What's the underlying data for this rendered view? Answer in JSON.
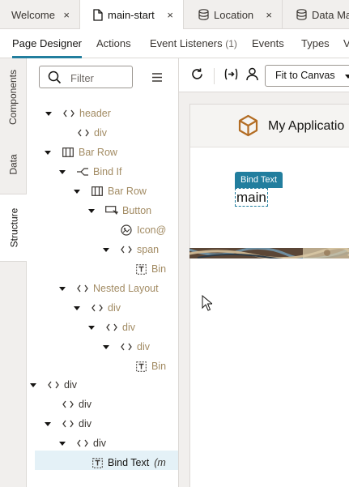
{
  "file_tabs": [
    {
      "label": "Welcome",
      "icon": "none",
      "active": false
    },
    {
      "label": "main-start",
      "icon": "file-icon",
      "active": true
    },
    {
      "label": "Location",
      "icon": "database-icon",
      "active": false
    },
    {
      "label": "Data Ma",
      "icon": "database-icon",
      "active": false
    }
  ],
  "close_glyph": "×",
  "editor_tabs": [
    {
      "label": "Page Designer",
      "count": "",
      "active": true
    },
    {
      "label": "Actions",
      "count": ""
    },
    {
      "label": "Event Listeners",
      "count": "(1)"
    },
    {
      "label": "Events",
      "count": ""
    },
    {
      "label": "Types",
      "count": ""
    },
    {
      "label": "V",
      "count": ""
    }
  ],
  "side_tabs": [
    "Components",
    "Data",
    "Structure"
  ],
  "structure": {
    "filter_placeholder": "Filter",
    "nodes": [
      {
        "label": "header",
        "icon": "code-icon",
        "twisty": true
      },
      {
        "label": "div",
        "icon": "code-icon",
        "twisty": false
      },
      {
        "label": "Bar Row",
        "icon": "bar-row-icon",
        "twisty": true
      },
      {
        "label": "Bind If",
        "icon": "bind-if-icon",
        "twisty": true
      },
      {
        "label": "Bar Row",
        "icon": "bar-row-icon",
        "twisty": true
      },
      {
        "label": "Button",
        "icon": "button-icon",
        "twisty": true
      },
      {
        "label": "Icon",
        "suffix": "@",
        "icon": "icon-component-icon",
        "twisty": false
      },
      {
        "label": "span",
        "icon": "code-icon",
        "twisty": true
      },
      {
        "label": "Bin",
        "icon": "bind-text-icon",
        "twisty": false
      },
      {
        "label": "Nested Layout",
        "icon": "code-icon",
        "twisty": true
      },
      {
        "label": "div",
        "icon": "code-icon",
        "twisty": true
      },
      {
        "label": "div",
        "icon": "code-icon",
        "twisty": true
      },
      {
        "label": "div",
        "icon": "code-icon",
        "twisty": true
      },
      {
        "label": "Bin",
        "icon": "bind-text-icon",
        "twisty": false
      },
      {
        "label": "div",
        "icon": "code-icon",
        "twisty": true
      },
      {
        "label": "div",
        "icon": "code-icon",
        "twisty": false
      },
      {
        "label": "div",
        "icon": "code-icon",
        "twisty": true
      },
      {
        "label": "div",
        "icon": "code-icon",
        "twisty": true
      },
      {
        "label": "Bind Text",
        "suffix": "(m",
        "icon": "bind-text-icon",
        "twisty": false,
        "selected": true
      }
    ]
  },
  "canvas_toolbar": {
    "zoom_select": "Fit to Canvas",
    "icons": [
      "refresh-icon",
      "variable-icon",
      "user-icon"
    ]
  },
  "canvas": {
    "app_title": "My Applicatio",
    "bind_text_badge": "Bind Text",
    "main_text": "main"
  },
  "colors": {
    "accent": "#227e9e",
    "logo": "#b36d24",
    "dim_node": "#a28b63",
    "selection": "#e4f1f7"
  }
}
